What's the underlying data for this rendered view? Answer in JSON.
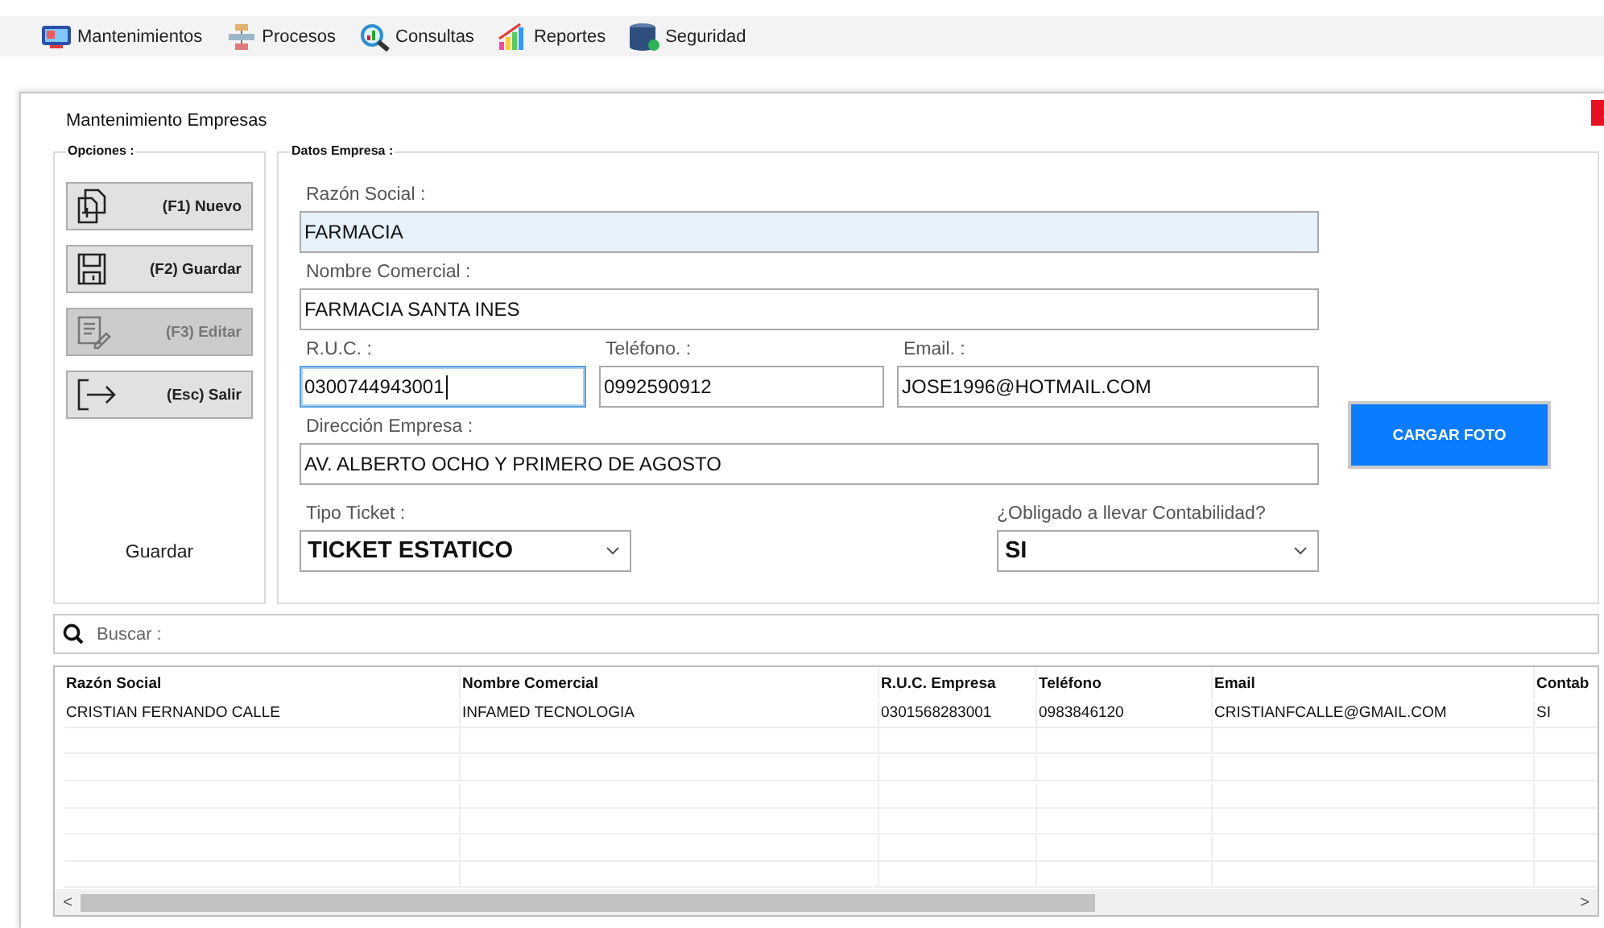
{
  "menu": [
    {
      "label": "Mantenimientos"
    },
    {
      "label": "Procesos"
    },
    {
      "label": "Consultas"
    },
    {
      "label": "Reportes"
    },
    {
      "label": "Seguridad"
    }
  ],
  "window": {
    "title": "Mantenimiento Empresas"
  },
  "options": {
    "title": "Opciones :",
    "buttons": [
      {
        "label": "(F1) Nuevo",
        "disabled": false
      },
      {
        "label": "(F2) Guardar",
        "disabled": false
      },
      {
        "label": "(F3) Editar",
        "disabled": true
      },
      {
        "label": "(Esc) Salir",
        "disabled": false
      }
    ],
    "status": "Guardar"
  },
  "form": {
    "title": "Datos Empresa :",
    "fields": [
      {
        "kind": "text",
        "label": "Razón Social :",
        "value": "FARMACIA",
        "focused": false,
        "highlighted": true
      },
      {
        "kind": "text",
        "label": "Nombre Comercial :",
        "value": "FARMACIA SANTA INES",
        "focused": false,
        "highlighted": false
      },
      {
        "kind": "text",
        "label": "R.U.C. :",
        "value": "0300744943001",
        "focused": true,
        "highlighted": false
      },
      {
        "kind": "text",
        "label": "Teléfono. :",
        "value": "0992590912",
        "focused": false,
        "highlighted": false
      },
      {
        "kind": "text",
        "label": "Email. :",
        "value": "JOSE1996@HOTMAIL.COM",
        "focused": false,
        "highlighted": false
      },
      {
        "kind": "text",
        "label": "Dirección Empresa :",
        "value": "AV. ALBERTO OCHO Y PRIMERO DE AGOSTO",
        "focused": false,
        "highlighted": false
      },
      {
        "kind": "select",
        "label": "Tipo Ticket :",
        "value": "TICKET ESTATICO"
      },
      {
        "kind": "select",
        "label": "¿Obligado a llevar Contabilidad?",
        "value": "SI"
      }
    ],
    "photo_button": "CARGAR FOTO"
  },
  "search": {
    "placeholder": "Buscar :"
  },
  "table": {
    "columns": [
      "Razón Social",
      "Nombre Comercial",
      "R.U.C. Empresa",
      "Teléfono",
      "Email",
      "Contab"
    ],
    "rows": [
      [
        "CRISTIAN FERNANDO CALLE",
        "INFAMED TECNOLOGIA",
        "0301568283001",
        "0983846120",
        "CRISTIANFCALLE@GMAIL.COM",
        "SI"
      ]
    ],
    "scroll_left": "<",
    "scroll_right": ">"
  }
}
